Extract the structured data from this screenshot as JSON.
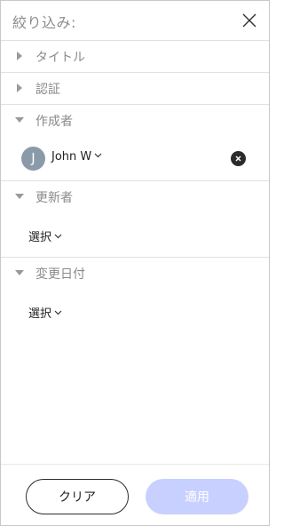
{
  "header": {
    "title": "絞り込み:"
  },
  "sections": {
    "title": {
      "label": "タイトル",
      "expanded": false
    },
    "auth": {
      "label": "認証",
      "expanded": false
    },
    "creator": {
      "label": "作成者",
      "expanded": true,
      "user": {
        "initial": "J",
        "name": "John W"
      }
    },
    "updater": {
      "label": "更新者",
      "expanded": true,
      "select_label": "選択"
    },
    "modified_date": {
      "label": "変更日付",
      "expanded": true,
      "select_label": "選択"
    }
  },
  "footer": {
    "clear_label": "クリア",
    "apply_label": "適用"
  },
  "colors": {
    "apply_disabled_bg": "#c8d0ff",
    "avatar_bg": "#8a9aa8"
  }
}
